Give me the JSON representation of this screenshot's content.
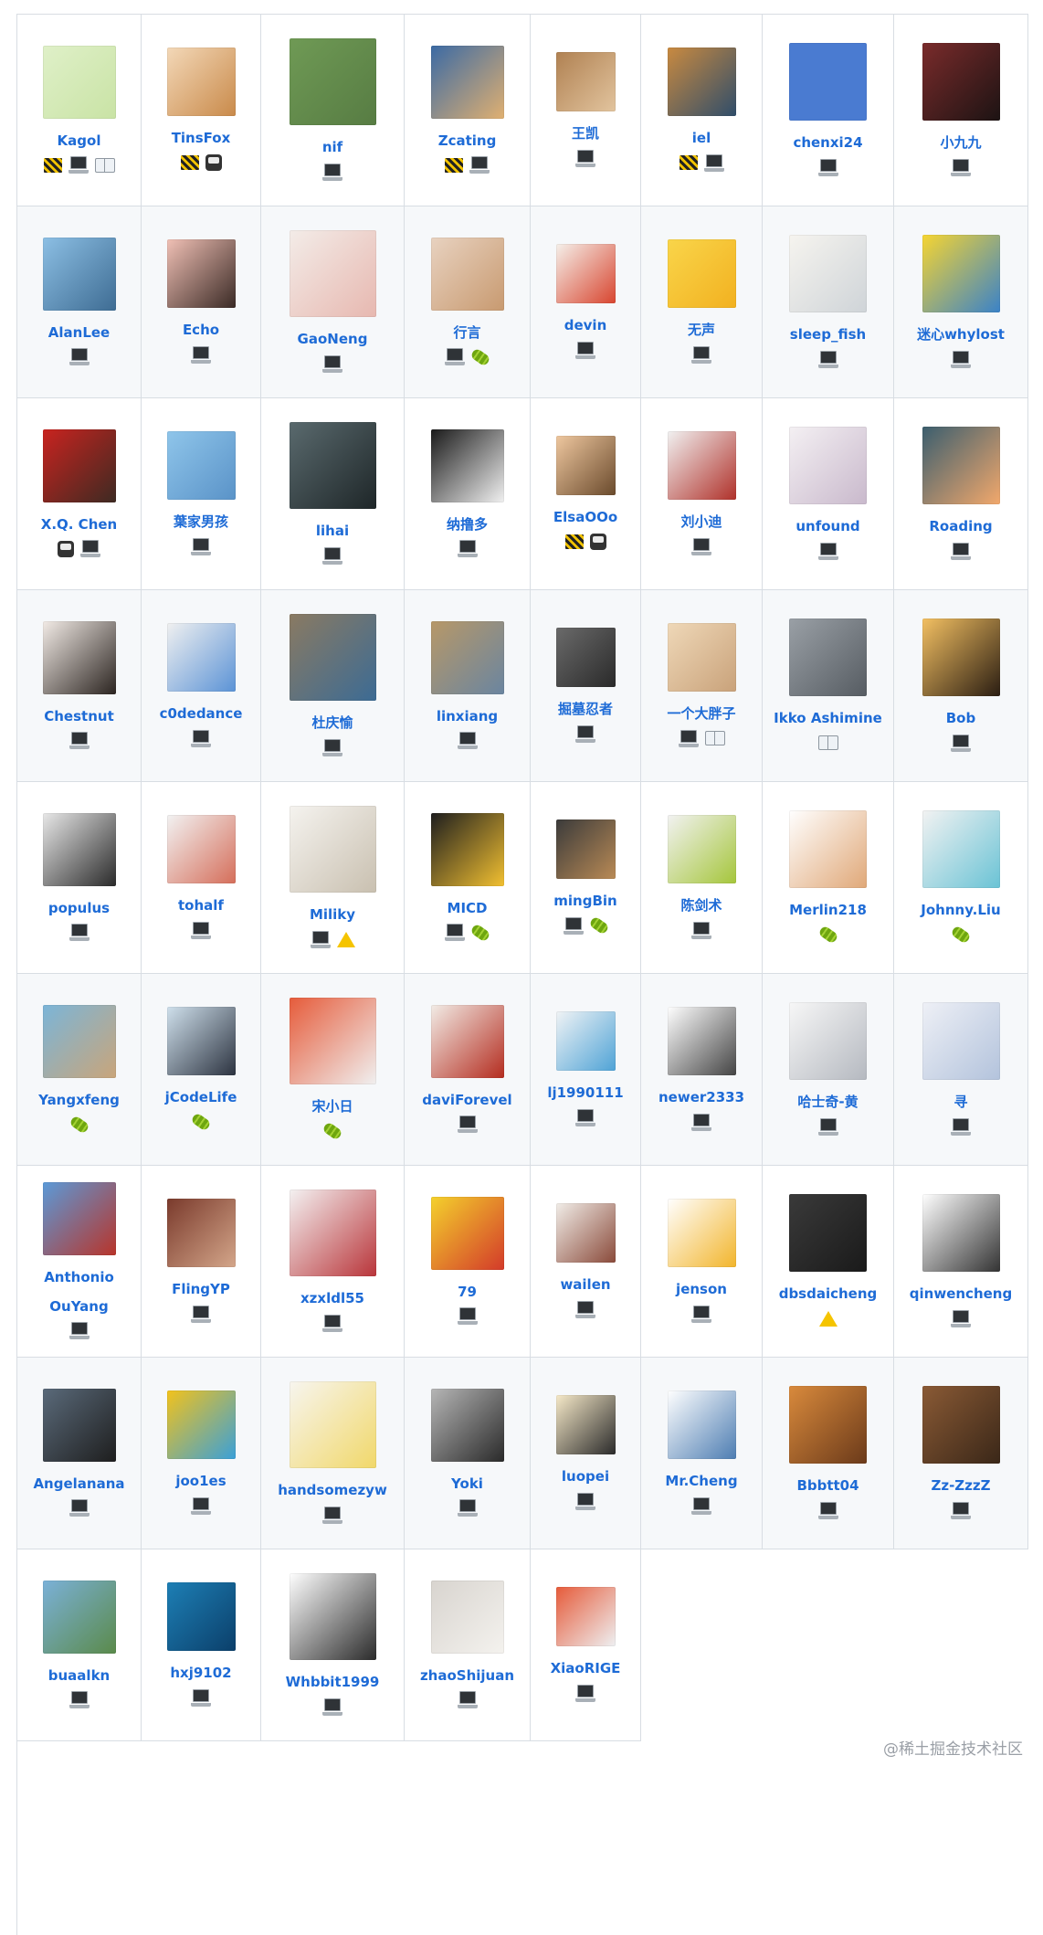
{
  "contributors": [
    {
      "name": "Kagol",
      "avatar": {
        "w": 80,
        "h": 80,
        "colors": [
          "#dff0c8",
          "#c9e3a5"
        ]
      },
      "contributions": [
        "construction-icon",
        "laptop-icon",
        "book-icon"
      ]
    },
    {
      "name": "TinsFox",
      "avatar": {
        "w": 75,
        "h": 75,
        "colors": [
          "#f3d8b8",
          "#c98a4a"
        ]
      },
      "contributions": [
        "construction-icon",
        "metro-icon"
      ]
    },
    {
      "name": "nif",
      "avatar": {
        "w": 95,
        "h": 95,
        "colors": [
          "#6f9a55",
          "#577c43"
        ]
      },
      "contributions": [
        "laptop-icon"
      ]
    },
    {
      "name": "Zcating",
      "avatar": {
        "w": 80,
        "h": 80,
        "colors": [
          "#3b6aa4",
          "#e0b071"
        ]
      },
      "contributions": [
        "construction-icon",
        "laptop-icon"
      ]
    },
    {
      "name": "王凯",
      "avatar": {
        "w": 65,
        "h": 65,
        "colors": [
          "#b08152",
          "#e2c49e"
        ]
      },
      "contributions": [
        "laptop-icon"
      ]
    },
    {
      "name": "iel",
      "avatar": {
        "w": 75,
        "h": 75,
        "colors": [
          "#c98a40",
          "#2f4d6a"
        ]
      },
      "contributions": [
        "construction-icon",
        "laptop-icon"
      ]
    },
    {
      "name": "chenxi24",
      "avatar": {
        "w": 85,
        "h": 85,
        "colors": [
          "#4a7bd1",
          "#4a7bd1"
        ]
      },
      "contributions": [
        "laptop-icon"
      ]
    },
    {
      "name": "小九九",
      "avatar": {
        "w": 85,
        "h": 85,
        "colors": [
          "#7a2b2b",
          "#1c1313"
        ]
      },
      "contributions": [
        "laptop-icon"
      ]
    },
    {
      "name": "AlanLee",
      "avatar": {
        "w": 80,
        "h": 80,
        "colors": [
          "#8cbfe4",
          "#3e6c93"
        ]
      },
      "contributions": [
        "laptop-icon"
      ]
    },
    {
      "name": "Echo",
      "avatar": {
        "w": 75,
        "h": 75,
        "colors": [
          "#f0c0b5",
          "#3a2a25"
        ]
      },
      "contributions": [
        "laptop-icon"
      ]
    },
    {
      "name": "GaoNeng",
      "avatar": {
        "w": 95,
        "h": 95,
        "colors": [
          "#f3ece8",
          "#e7b8b0"
        ]
      },
      "contributions": [
        "laptop-icon"
      ]
    },
    {
      "name": "行言",
      "avatar": {
        "w": 80,
        "h": 80,
        "colors": [
          "#e8d2c0",
          "#c89a70"
        ]
      },
      "contributions": [
        "laptop-icon",
        "caterpillar-icon"
      ]
    },
    {
      "name": "devin",
      "avatar": {
        "w": 65,
        "h": 65,
        "colors": [
          "#f5f0ea",
          "#d8452f"
        ]
      },
      "contributions": [
        "laptop-icon"
      ]
    },
    {
      "name": "无声",
      "avatar": {
        "w": 75,
        "h": 75,
        "colors": [
          "#f9d54a",
          "#f2b120"
        ]
      },
      "contributions": [
        "laptop-icon"
      ]
    },
    {
      "name": "sleep_fish",
      "avatar": {
        "w": 85,
        "h": 85,
        "colors": [
          "#f6f4ef",
          "#cfd4d8"
        ]
      },
      "contributions": [
        "laptop-icon"
      ]
    },
    {
      "name": "迷心whylost",
      "avatar": {
        "w": 85,
        "h": 85,
        "colors": [
          "#f6d531",
          "#3a82c8"
        ]
      },
      "contributions": [
        "laptop-icon"
      ]
    },
    {
      "name": "X.Q. Chen",
      "avatar": {
        "w": 80,
        "h": 80,
        "colors": [
          "#c9231f",
          "#3d2a22"
        ]
      },
      "contributions": [
        "metro-icon",
        "laptop-icon"
      ]
    },
    {
      "name": "葉家男孩",
      "avatar": {
        "w": 75,
        "h": 75,
        "colors": [
          "#8fc5ea",
          "#5a93c8"
        ]
      },
      "contributions": [
        "laptop-icon"
      ]
    },
    {
      "name": "lihai",
      "avatar": {
        "w": 95,
        "h": 95,
        "colors": [
          "#5a6a6e",
          "#1e2628"
        ]
      },
      "contributions": [
        "laptop-icon"
      ]
    },
    {
      "name": "纳撸多",
      "avatar": {
        "w": 80,
        "h": 80,
        "colors": [
          "#1a1a1a",
          "#f1f1f1"
        ]
      },
      "contributions": [
        "laptop-icon"
      ]
    },
    {
      "name": "ElsaOOo",
      "avatar": {
        "w": 65,
        "h": 65,
        "colors": [
          "#eec79f",
          "#6a4a2c"
        ]
      },
      "contributions": [
        "construction-icon",
        "metro-icon"
      ]
    },
    {
      "name": "刘小迪",
      "avatar": {
        "w": 75,
        "h": 75,
        "colors": [
          "#f1f1f1",
          "#b0312a"
        ]
      },
      "contributions": [
        "laptop-icon"
      ]
    },
    {
      "name": "unfound",
      "avatar": {
        "w": 85,
        "h": 85,
        "colors": [
          "#f4f0f3",
          "#c9b9cc"
        ]
      },
      "contributions": [
        "laptop-icon"
      ]
    },
    {
      "name": "Roading",
      "avatar": {
        "w": 85,
        "h": 85,
        "colors": [
          "#3b5e6e",
          "#f2a86c"
        ]
      },
      "contributions": [
        "laptop-icon"
      ]
    },
    {
      "name": "Chestnut",
      "avatar": {
        "w": 80,
        "h": 80,
        "colors": [
          "#f2ebe6",
          "#2b2420"
        ]
      },
      "contributions": [
        "laptop-icon"
      ]
    },
    {
      "name": "c0dedance",
      "avatar": {
        "w": 75,
        "h": 75,
        "colors": [
          "#f0f0f0",
          "#5b93d6"
        ]
      },
      "contributions": [
        "laptop-icon"
      ]
    },
    {
      "name": "杜庆愉",
      "avatar": {
        "w": 95,
        "h": 95,
        "colors": [
          "#8a7a62",
          "#3c6b94"
        ]
      },
      "contributions": [
        "laptop-icon"
      ]
    },
    {
      "name": "linxiang",
      "avatar": {
        "w": 80,
        "h": 80,
        "colors": [
          "#b79868",
          "#6a85a0"
        ]
      },
      "contributions": [
        "laptop-icon"
      ]
    },
    {
      "name": "掘墓忍者",
      "avatar": {
        "w": 65,
        "h": 65,
        "colors": [
          "#6a6a6a",
          "#2a2a2a"
        ]
      },
      "contributions": [
        "laptop-icon"
      ]
    },
    {
      "name": "一个大胖子",
      "avatar": {
        "w": 75,
        "h": 75,
        "colors": [
          "#efd8b8",
          "#c9a27a"
        ]
      },
      "contributions": [
        "laptop-icon",
        "book-icon"
      ]
    },
    {
      "name": "Ikko Ashimine",
      "avatar": {
        "w": 85,
        "h": 85,
        "colors": [
          "#9aa0a6",
          "#565c62"
        ]
      },
      "contributions": [
        "book-icon"
      ]
    },
    {
      "name": "Bob",
      "avatar": {
        "w": 85,
        "h": 85,
        "colors": [
          "#f3c062",
          "#2a1d12"
        ]
      },
      "contributions": [
        "laptop-icon"
      ]
    },
    {
      "name": "populus",
      "avatar": {
        "w": 80,
        "h": 80,
        "colors": [
          "#e8e8e8",
          "#2a2a2a"
        ]
      },
      "contributions": [
        "laptop-icon"
      ]
    },
    {
      "name": "tohalf",
      "avatar": {
        "w": 75,
        "h": 75,
        "colors": [
          "#f2f2f2",
          "#d56e5a"
        ]
      },
      "contributions": [
        "laptop-icon"
      ]
    },
    {
      "name": "Miliky",
      "avatar": {
        "w": 95,
        "h": 95,
        "colors": [
          "#f5f3ef",
          "#c9c0b0"
        ]
      },
      "contributions": [
        "laptop-icon",
        "warning-icon"
      ]
    },
    {
      "name": "MICD",
      "avatar": {
        "w": 80,
        "h": 80,
        "colors": [
          "#1e1e1e",
          "#f2c031"
        ]
      },
      "contributions": [
        "laptop-icon",
        "caterpillar-icon"
      ]
    },
    {
      "name": "mingBin",
      "avatar": {
        "w": 65,
        "h": 65,
        "colors": [
          "#3b3b3b",
          "#b98a55"
        ]
      },
      "contributions": [
        "laptop-icon",
        "caterpillar-icon"
      ]
    },
    {
      "name": "陈剑术",
      "avatar": {
        "w": 75,
        "h": 75,
        "colors": [
          "#f2f2f2",
          "#a5c63b"
        ]
      },
      "contributions": [
        "laptop-icon"
      ]
    },
    {
      "name": "Merlin218",
      "avatar": {
        "w": 85,
        "h": 85,
        "colors": [
          "#ffffff",
          "#e0a878"
        ]
      },
      "contributions": [
        "caterpillar-icon"
      ]
    },
    {
      "name": "Johnny.Liu",
      "avatar": {
        "w": 85,
        "h": 85,
        "colors": [
          "#f2f2f2",
          "#6ac3d5"
        ]
      },
      "contributions": [
        "caterpillar-icon"
      ]
    },
    {
      "name": "Yangxfeng",
      "avatar": {
        "w": 80,
        "h": 80,
        "colors": [
          "#7bb5d8",
          "#c9a57a"
        ]
      },
      "contributions": [
        "caterpillar-icon"
      ]
    },
    {
      "name": "jCodeLife",
      "avatar": {
        "w": 75,
        "h": 75,
        "colors": [
          "#cfe0ec",
          "#2c3340"
        ]
      },
      "contributions": [
        "caterpillar-icon"
      ]
    },
    {
      "name": "宋小日",
      "avatar": {
        "w": 95,
        "h": 95,
        "colors": [
          "#e65b3a",
          "#f0f0f0"
        ]
      },
      "contributions": [
        "caterpillar-icon"
      ]
    },
    {
      "name": "daviForevel",
      "avatar": {
        "w": 80,
        "h": 80,
        "colors": [
          "#f2ece6",
          "#b42c1f"
        ]
      },
      "contributions": [
        "laptop-icon"
      ]
    },
    {
      "name": "lj1990111",
      "avatar": {
        "w": 65,
        "h": 65,
        "colors": [
          "#f0f3f5",
          "#4fa3d6"
        ]
      },
      "contributions": [
        "laptop-icon"
      ]
    },
    {
      "name": "newer2333",
      "avatar": {
        "w": 75,
        "h": 75,
        "colors": [
          "#ffffff",
          "#444444"
        ]
      },
      "contributions": [
        "laptop-icon"
      ]
    },
    {
      "name": "哈士奇-黄",
      "avatar": {
        "w": 85,
        "h": 85,
        "colors": [
          "#f7f7f7",
          "#b5b9c0"
        ]
      },
      "contributions": [
        "laptop-icon"
      ]
    },
    {
      "name": "寻",
      "avatar": {
        "w": 85,
        "h": 85,
        "colors": [
          "#eef0f6",
          "#b3c3dc"
        ]
      },
      "contributions": [
        "laptop-icon"
      ]
    },
    {
      "name": "Anthonio OuYang",
      "avatar": {
        "w": 80,
        "h": 80,
        "colors": [
          "#5b9ad8",
          "#b8342a"
        ]
      },
      "contributions": [
        "laptop-icon"
      ]
    },
    {
      "name": "FlingYP",
      "avatar": {
        "w": 75,
        "h": 75,
        "colors": [
          "#7a3a2c",
          "#d4a68a"
        ]
      },
      "contributions": [
        "laptop-icon"
      ]
    },
    {
      "name": "xzxldl55",
      "avatar": {
        "w": 95,
        "h": 95,
        "colors": [
          "#f4f2f2",
          "#b9353a"
        ]
      },
      "contributions": [
        "laptop-icon"
      ]
    },
    {
      "name": "79",
      "avatar": {
        "w": 80,
        "h": 80,
        "colors": [
          "#f4d12c",
          "#d33a2a"
        ]
      },
      "contributions": [
        "laptop-icon"
      ]
    },
    {
      "name": "wailen",
      "avatar": {
        "w": 65,
        "h": 65,
        "colors": [
          "#f1ede8",
          "#8a4a3a"
        ]
      },
      "contributions": [
        "laptop-icon"
      ]
    },
    {
      "name": "jenson",
      "avatar": {
        "w": 75,
        "h": 75,
        "colors": [
          "#ffffff",
          "#f2b52c"
        ]
      },
      "contributions": [
        "laptop-icon"
      ]
    },
    {
      "name": "dbsdaicheng",
      "avatar": {
        "w": 85,
        "h": 85,
        "colors": [
          "#3a3a3a",
          "#1a1a1a"
        ]
      },
      "contributions": [
        "warning-icon"
      ]
    },
    {
      "name": "qinwencheng",
      "avatar": {
        "w": 85,
        "h": 85,
        "colors": [
          "#ffffff",
          "#333333"
        ]
      },
      "contributions": [
        "laptop-icon"
      ]
    },
    {
      "name": "Angelanana",
      "avatar": {
        "w": 80,
        "h": 80,
        "colors": [
          "#5a6a7a",
          "#1e1e1e"
        ]
      },
      "contributions": [
        "laptop-icon"
      ]
    },
    {
      "name": "joo1es",
      "avatar": {
        "w": 75,
        "h": 75,
        "colors": [
          "#f2c21c",
          "#3aa0d8"
        ]
      },
      "contributions": [
        "laptop-icon"
      ]
    },
    {
      "name": "handsomezyw",
      "avatar": {
        "w": 95,
        "h": 95,
        "colors": [
          "#f7f5ef",
          "#f1d86a"
        ]
      },
      "contributions": [
        "laptop-icon"
      ]
    },
    {
      "name": "Yoki",
      "avatar": {
        "w": 80,
        "h": 80,
        "colors": [
          "#b6b6b6",
          "#2a2a2a"
        ]
      },
      "contributions": [
        "laptop-icon"
      ]
    },
    {
      "name": "luopei",
      "avatar": {
        "w": 65,
        "h": 65,
        "colors": [
          "#f6e9c8",
          "#2a2a2a"
        ]
      },
      "contributions": [
        "laptop-icon"
      ]
    },
    {
      "name": "Mr.Cheng",
      "avatar": {
        "w": 75,
        "h": 75,
        "colors": [
          "#ffffff",
          "#4d7db2"
        ]
      },
      "contributions": [
        "laptop-icon"
      ]
    },
    {
      "name": "Bbbtt04",
      "avatar": {
        "w": 85,
        "h": 85,
        "colors": [
          "#d98a3c",
          "#6b3a1a"
        ]
      },
      "contributions": [
        "laptop-icon"
      ]
    },
    {
      "name": "Zz-ZzzZ",
      "avatar": {
        "w": 85,
        "h": 85,
        "colors": [
          "#8a5a35",
          "#3a2718"
        ]
      },
      "contributions": [
        "laptop-icon"
      ]
    },
    {
      "name": "buaalkn",
      "avatar": {
        "w": 80,
        "h": 80,
        "colors": [
          "#7bb1d8",
          "#5a8a4a"
        ]
      },
      "contributions": [
        "laptop-icon"
      ]
    },
    {
      "name": "hxj9102",
      "avatar": {
        "w": 75,
        "h": 75,
        "colors": [
          "#1d7fb5",
          "#0b3f6a"
        ]
      },
      "contributions": [
        "laptop-icon"
      ]
    },
    {
      "name": "Whbbit1999",
      "avatar": {
        "w": 95,
        "h": 95,
        "colors": [
          "#ffffff",
          "#2b2b2b"
        ]
      },
      "contributions": [
        "laptop-icon"
      ]
    },
    {
      "name": "zhaoShijuan",
      "avatar": {
        "w": 80,
        "h": 80,
        "colors": [
          "#d8d4cf",
          "#f4f2ee"
        ]
      },
      "contributions": [
        "laptop-icon"
      ]
    },
    {
      "name": "XiaoRIGE",
      "avatar": {
        "w": 65,
        "h": 65,
        "colors": [
          "#e65b3a",
          "#eef0f2"
        ]
      },
      "contributions": [
        "laptop-icon"
      ]
    }
  ],
  "watermark": "@稀土掘金技术社区",
  "colors": {
    "link": "#1e6bd6",
    "border": "#d8dde3",
    "alt_bg": "#f6f8fa"
  }
}
